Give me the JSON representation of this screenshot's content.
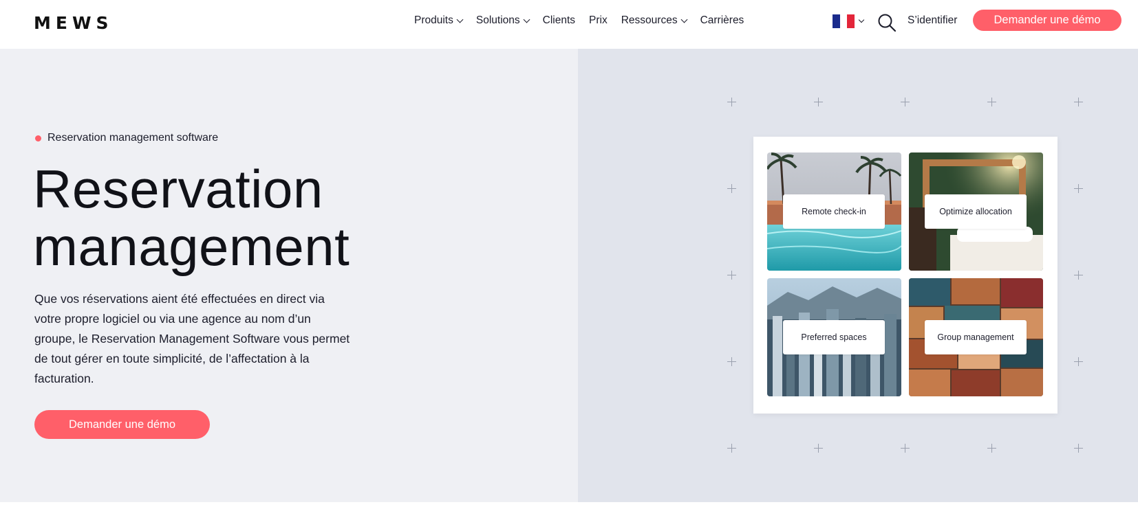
{
  "header": {
    "logo": "MEWS",
    "nav": [
      {
        "label": "Produits",
        "dropdown": true
      },
      {
        "label": "Solutions",
        "dropdown": true
      },
      {
        "label": "Clients",
        "dropdown": false
      },
      {
        "label": "Prix",
        "dropdown": false
      },
      {
        "label": "Ressources",
        "dropdown": true
      },
      {
        "label": "Carrières",
        "dropdown": false
      }
    ],
    "language_flag": "france-flag-icon",
    "signin_label": "S’identifier",
    "cta_label": "Demander une démo"
  },
  "hero": {
    "eyebrow": "Reservation management software",
    "title": "Reservation management",
    "description": "Que vos réservations aient été effectuées en direct via votre propre logiciel ou via une agence au nom d’un groupe, le Reservation Management Software vous permet de tout gérer en toute simplicité, de l’affectation à la facturation.",
    "cta_label": "Demander une démo"
  },
  "feature_tiles": [
    {
      "label": "Remote check-in",
      "image": "hotel-pool-palms-image"
    },
    {
      "label": "Optimize allocation",
      "image": "hotel-room-bed-image"
    },
    {
      "label": "Preferred spaces",
      "image": "city-skyline-image"
    },
    {
      "label": "Group management",
      "image": "stacked-suitcases-image"
    }
  ],
  "colors": {
    "accent": "#ff5f69",
    "hero_left_bg": "#eff0f4",
    "hero_right_bg": "#e1e4ec",
    "text": "#1c1d2b"
  }
}
